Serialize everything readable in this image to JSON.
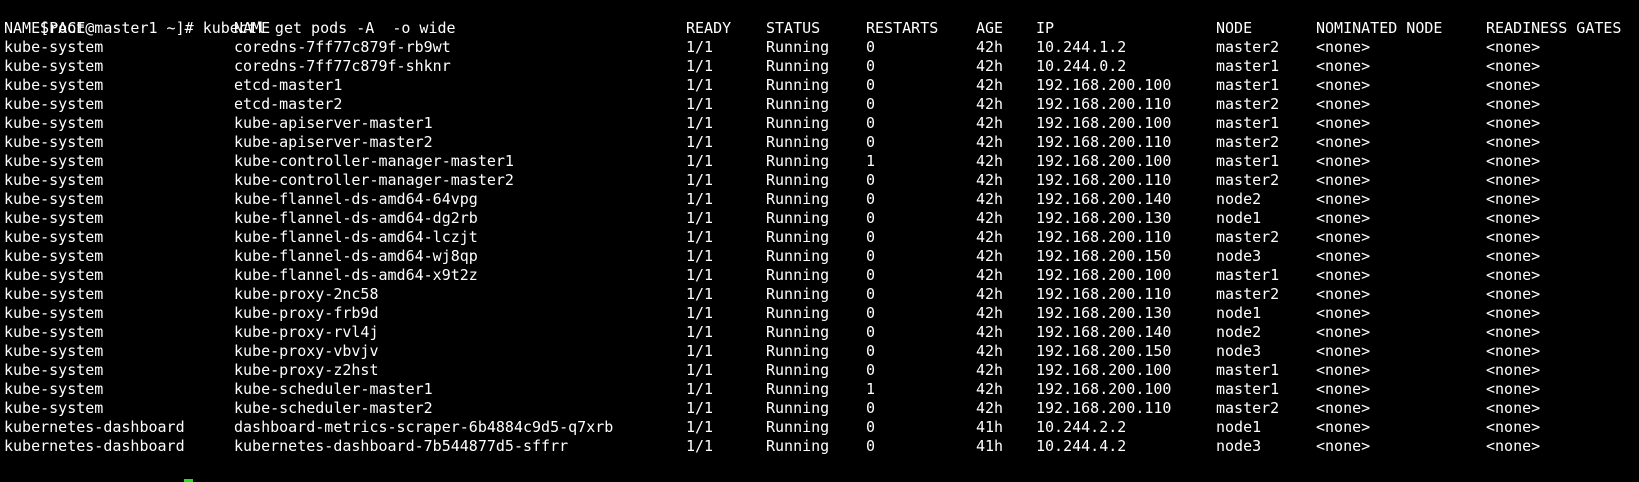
{
  "terminal": {
    "prompt": "[root@master1 ~]# ",
    "command": "kubectl get pods -A  -o wide",
    "cursor_color": "#22dd22"
  },
  "table": {
    "headers": [
      "NAMESPACE",
      "NAME",
      "READY",
      "STATUS",
      "RESTARTS",
      "AGE",
      "IP",
      "NODE",
      "NOMINATED NODE",
      "READINESS GATES"
    ],
    "rows": [
      [
        "kube-system",
        "coredns-7ff77c879f-rb9wt",
        "1/1",
        "Running",
        "0",
        "42h",
        "10.244.1.2",
        "master2",
        "<none>",
        "<none>"
      ],
      [
        "kube-system",
        "coredns-7ff77c879f-shknr",
        "1/1",
        "Running",
        "0",
        "42h",
        "10.244.0.2",
        "master1",
        "<none>",
        "<none>"
      ],
      [
        "kube-system",
        "etcd-master1",
        "1/1",
        "Running",
        "0",
        "42h",
        "192.168.200.100",
        "master1",
        "<none>",
        "<none>"
      ],
      [
        "kube-system",
        "etcd-master2",
        "1/1",
        "Running",
        "0",
        "42h",
        "192.168.200.110",
        "master2",
        "<none>",
        "<none>"
      ],
      [
        "kube-system",
        "kube-apiserver-master1",
        "1/1",
        "Running",
        "0",
        "42h",
        "192.168.200.100",
        "master1",
        "<none>",
        "<none>"
      ],
      [
        "kube-system",
        "kube-apiserver-master2",
        "1/1",
        "Running",
        "0",
        "42h",
        "192.168.200.110",
        "master2",
        "<none>",
        "<none>"
      ],
      [
        "kube-system",
        "kube-controller-manager-master1",
        "1/1",
        "Running",
        "1",
        "42h",
        "192.168.200.100",
        "master1",
        "<none>",
        "<none>"
      ],
      [
        "kube-system",
        "kube-controller-manager-master2",
        "1/1",
        "Running",
        "0",
        "42h",
        "192.168.200.110",
        "master2",
        "<none>",
        "<none>"
      ],
      [
        "kube-system",
        "kube-flannel-ds-amd64-64vpg",
        "1/1",
        "Running",
        "0",
        "42h",
        "192.168.200.140",
        "node2",
        "<none>",
        "<none>"
      ],
      [
        "kube-system",
        "kube-flannel-ds-amd64-dg2rb",
        "1/1",
        "Running",
        "0",
        "42h",
        "192.168.200.130",
        "node1",
        "<none>",
        "<none>"
      ],
      [
        "kube-system",
        "kube-flannel-ds-amd64-lczjt",
        "1/1",
        "Running",
        "0",
        "42h",
        "192.168.200.110",
        "master2",
        "<none>",
        "<none>"
      ],
      [
        "kube-system",
        "kube-flannel-ds-amd64-wj8qp",
        "1/1",
        "Running",
        "0",
        "42h",
        "192.168.200.150",
        "node3",
        "<none>",
        "<none>"
      ],
      [
        "kube-system",
        "kube-flannel-ds-amd64-x9t2z",
        "1/1",
        "Running",
        "0",
        "42h",
        "192.168.200.100",
        "master1",
        "<none>",
        "<none>"
      ],
      [
        "kube-system",
        "kube-proxy-2nc58",
        "1/1",
        "Running",
        "0",
        "42h",
        "192.168.200.110",
        "master2",
        "<none>",
        "<none>"
      ],
      [
        "kube-system",
        "kube-proxy-frb9d",
        "1/1",
        "Running",
        "0",
        "42h",
        "192.168.200.130",
        "node1",
        "<none>",
        "<none>"
      ],
      [
        "kube-system",
        "kube-proxy-rvl4j",
        "1/1",
        "Running",
        "0",
        "42h",
        "192.168.200.140",
        "node2",
        "<none>",
        "<none>"
      ],
      [
        "kube-system",
        "kube-proxy-vbvjv",
        "1/1",
        "Running",
        "0",
        "42h",
        "192.168.200.150",
        "node3",
        "<none>",
        "<none>"
      ],
      [
        "kube-system",
        "kube-proxy-z2hst",
        "1/1",
        "Running",
        "0",
        "42h",
        "192.168.200.100",
        "master1",
        "<none>",
        "<none>"
      ],
      [
        "kube-system",
        "kube-scheduler-master1",
        "1/1",
        "Running",
        "1",
        "42h",
        "192.168.200.100",
        "master1",
        "<none>",
        "<none>"
      ],
      [
        "kube-system",
        "kube-scheduler-master2",
        "1/1",
        "Running",
        "0",
        "42h",
        "192.168.200.110",
        "master2",
        "<none>",
        "<none>"
      ],
      [
        "kubernetes-dashboard",
        "dashboard-metrics-scraper-6b4884c9d5-q7xrb",
        "1/1",
        "Running",
        "0",
        "41h",
        "10.244.2.2",
        "node1",
        "<none>",
        "<none>"
      ],
      [
        "kubernetes-dashboard",
        "kubernetes-dashboard-7b544877d5-sffrr",
        "1/1",
        "Running",
        "0",
        "41h",
        "10.244.4.2",
        "node3",
        "<none>",
        "<none>"
      ]
    ]
  }
}
